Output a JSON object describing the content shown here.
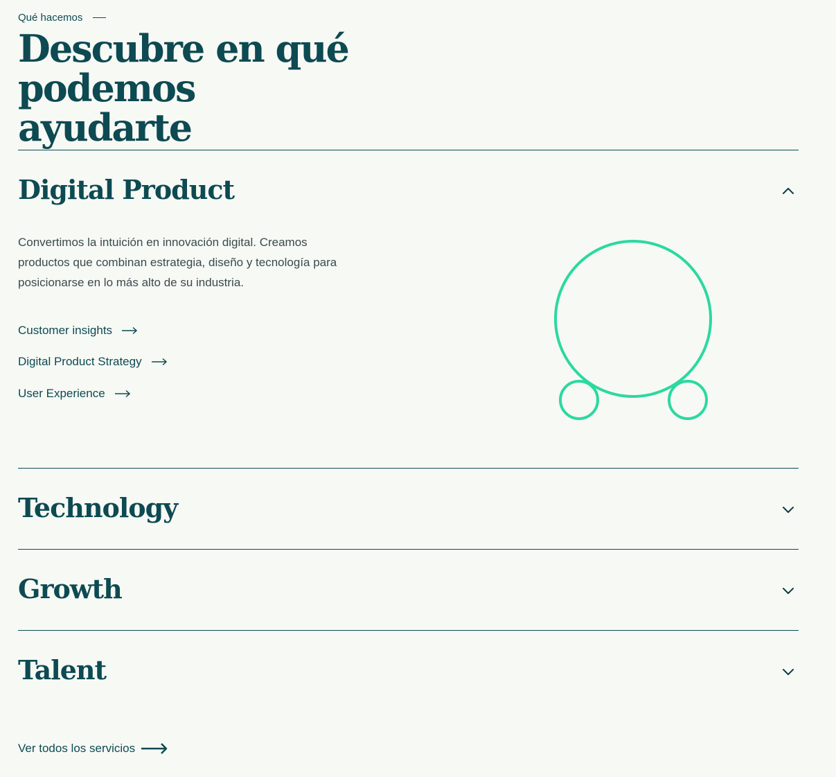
{
  "eyebrow": "Qué hacemos",
  "headline": {
    "line1": "Descubre en qué",
    "line2": "podemos ayudarte"
  },
  "accordion": [
    {
      "title": "Digital Product",
      "expanded": true,
      "chevron_icon": "chevron-up-icon",
      "description": "Convertimos la intuición en innovación digital. Creamos productos que combinan estrategia, diseño y tecnología para posicionarse en lo más alto de su industria.",
      "links": [
        "Customer insights",
        "Digital Product Strategy",
        "User Experience"
      ]
    },
    {
      "title": "Technology",
      "expanded": false,
      "chevron_icon": "chevron-down-icon"
    },
    {
      "title": "Growth",
      "expanded": false,
      "chevron_icon": "chevron-down-icon"
    },
    {
      "title": "Talent",
      "expanded": false,
      "chevron_icon": "chevron-down-icon"
    }
  ],
  "view_all_label": "Ver todos los servicios",
  "colors": {
    "background": "#f7f9f5",
    "primary": "#0d4a52",
    "accent": "#2bd9a0",
    "body_text": "#3a4a4c"
  }
}
